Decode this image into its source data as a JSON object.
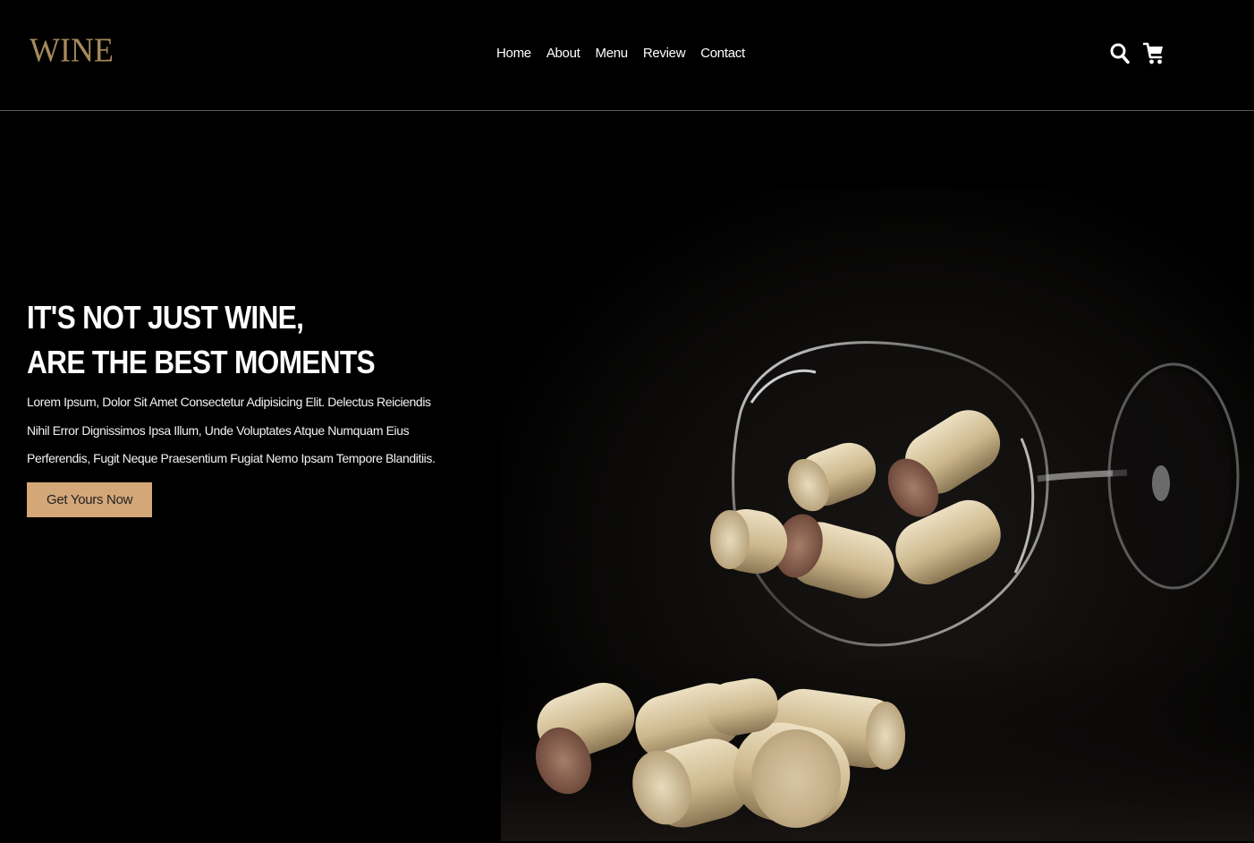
{
  "header": {
    "logo": "WINE",
    "nav": [
      {
        "label": "Home"
      },
      {
        "label": "About"
      },
      {
        "label": "Menu"
      },
      {
        "label": "Review"
      },
      {
        "label": "Contact"
      }
    ],
    "icons": [
      "search-icon",
      "cart-icon"
    ]
  },
  "hero": {
    "title_line1": "IT'S NOT JUST WINE,",
    "title_line2": "ARE THE BEST MOMENTS",
    "description": "Lorem Ipsum, Dolor Sit Amet Consectetur Adipisicing Elit. Delectus Reiciendis Nihil Error Dignissimos Ipsa Illum, Unde Voluptates Atque Numquam Eius Perferendis, Fugit Neque Praesentium Fugiat Nemo Ipsam Tempore Blanditiis.",
    "cta_label": "Get Yours Now",
    "image": "wine-glass-with-corks"
  },
  "colors": {
    "background": "#000000",
    "accent": "#d4a779",
    "logo": "#a88a5c"
  }
}
